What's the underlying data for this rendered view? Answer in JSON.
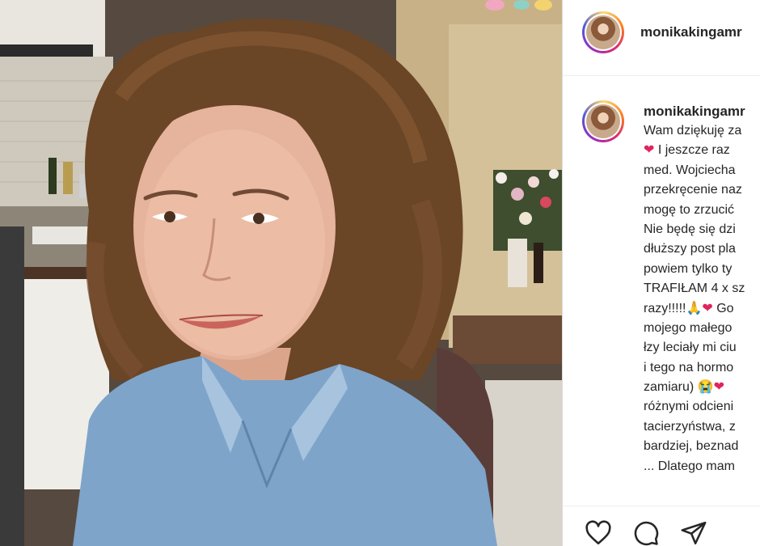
{
  "post": {
    "username": "monikakingamr",
    "caption_lines": [
      "Wam dziękuję za",
      "I jeszcze raz",
      "med. Wojciecha",
      "przekręcenie naz",
      "mogę to zrzucić",
      "Nie będę się dzi",
      "dłuższy post pla",
      "powiem tylko ty",
      "TRAFIŁAM 4 x sz",
      "razy!!!!!",
      "mojego małego",
      "łzy leciały mi ciu",
      "i tego na hormo",
      "zamiaru)",
      "różnymi odcieni",
      "tacierzyństwa, z",
      "bardziej, beznad",
      "... Dlatego mam"
    ],
    "emoji": {
      "heart": "❤",
      "praying_hands": "🙏",
      "crying_face": "😭",
      "trailing_text": "Go"
    },
    "action_icons": [
      "heart-icon",
      "comment-icon",
      "share-icon"
    ]
  }
}
